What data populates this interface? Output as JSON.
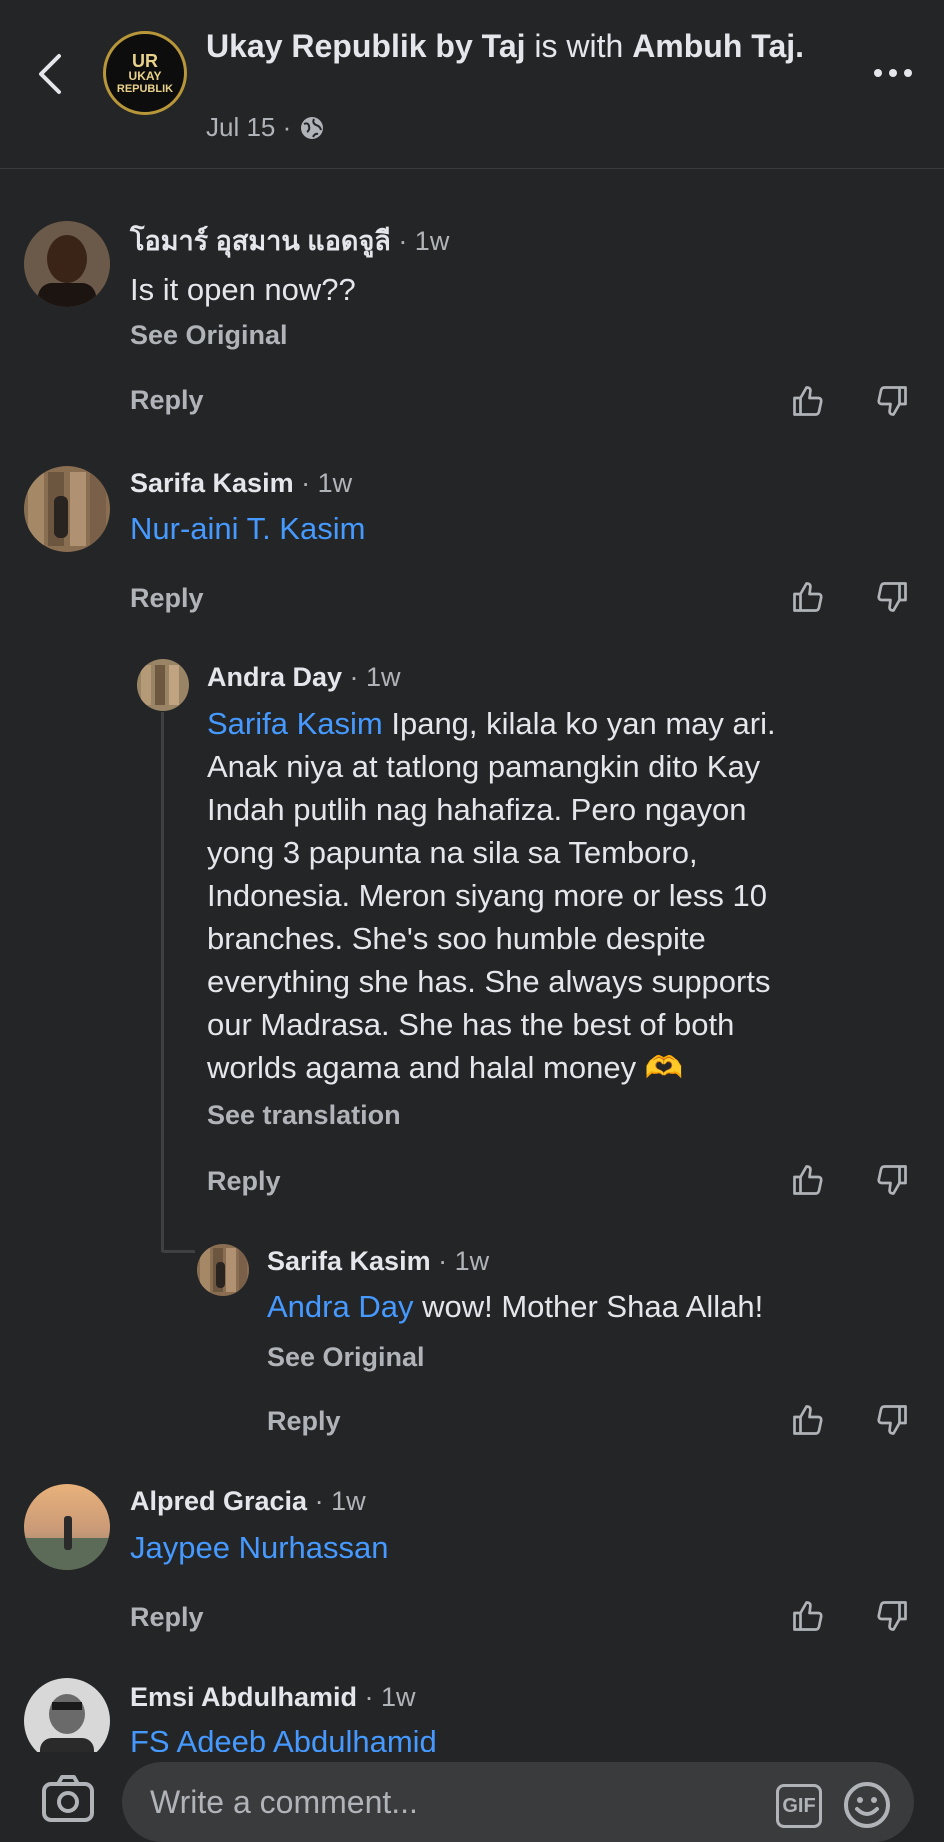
{
  "header": {
    "page_name": "Ukay Republik by Taj",
    "with_text": " is with ",
    "tagged": "Ambuh Taj.",
    "date": "Jul 15 ·",
    "avatar_line1": "UKAY",
    "avatar_line2": "REPUBLIK",
    "avatar_crest": "UR"
  },
  "comments": [
    {
      "name": "โอมาร์ อุสมาน แอดจูลี",
      "ago": " · 1w",
      "text": "Is it open now??",
      "see": "See Original",
      "reply": "Reply"
    },
    {
      "name": "Sarifa Kasim",
      "ago": " · 1w",
      "mention": "Nur-aini T. Kasim",
      "reply": "Reply"
    },
    {
      "name": "Andra Day",
      "ago": " · 1w",
      "mention": "Sarifa Kasim",
      "lines": [
        " Ipang, kilala ko yan may ari.",
        "Anak niya at tatlong pamangkin dito Kay",
        "Indah putlih nag hahafiza. Pero ngayon",
        "yong 3 papunta na sila sa Temboro,",
        "Indonesia. Meron siyang more or less 10",
        "branches. She's soo humble despite",
        "everything she has. She always supports",
        "our Madrasa. She has the best of both",
        "worlds agama and halal money"
      ],
      "emoji": "🫶",
      "see": "See translation",
      "reply": "Reply"
    },
    {
      "name": "Sarifa Kasim",
      "ago": " · 1w",
      "mention": "Andra Day",
      "text": " wow! Mother Shaa Allah!",
      "see": "See Original",
      "reply": "Reply"
    },
    {
      "name": "Alpred Gracia",
      "ago": " · 1w",
      "mention": "Jaypee Nurhassan",
      "reply": "Reply"
    },
    {
      "name": "Emsi Abdulhamid",
      "ago": " · 1w",
      "mention": "FS Adeeb Abdulhamid"
    }
  ],
  "composer": {
    "placeholder": "Write a comment...",
    "gif": "GIF"
  },
  "colors": {
    "background": "#242526",
    "mention": "#4599ff",
    "muted": "#b0b3b8",
    "text": "#e4e6eb"
  }
}
